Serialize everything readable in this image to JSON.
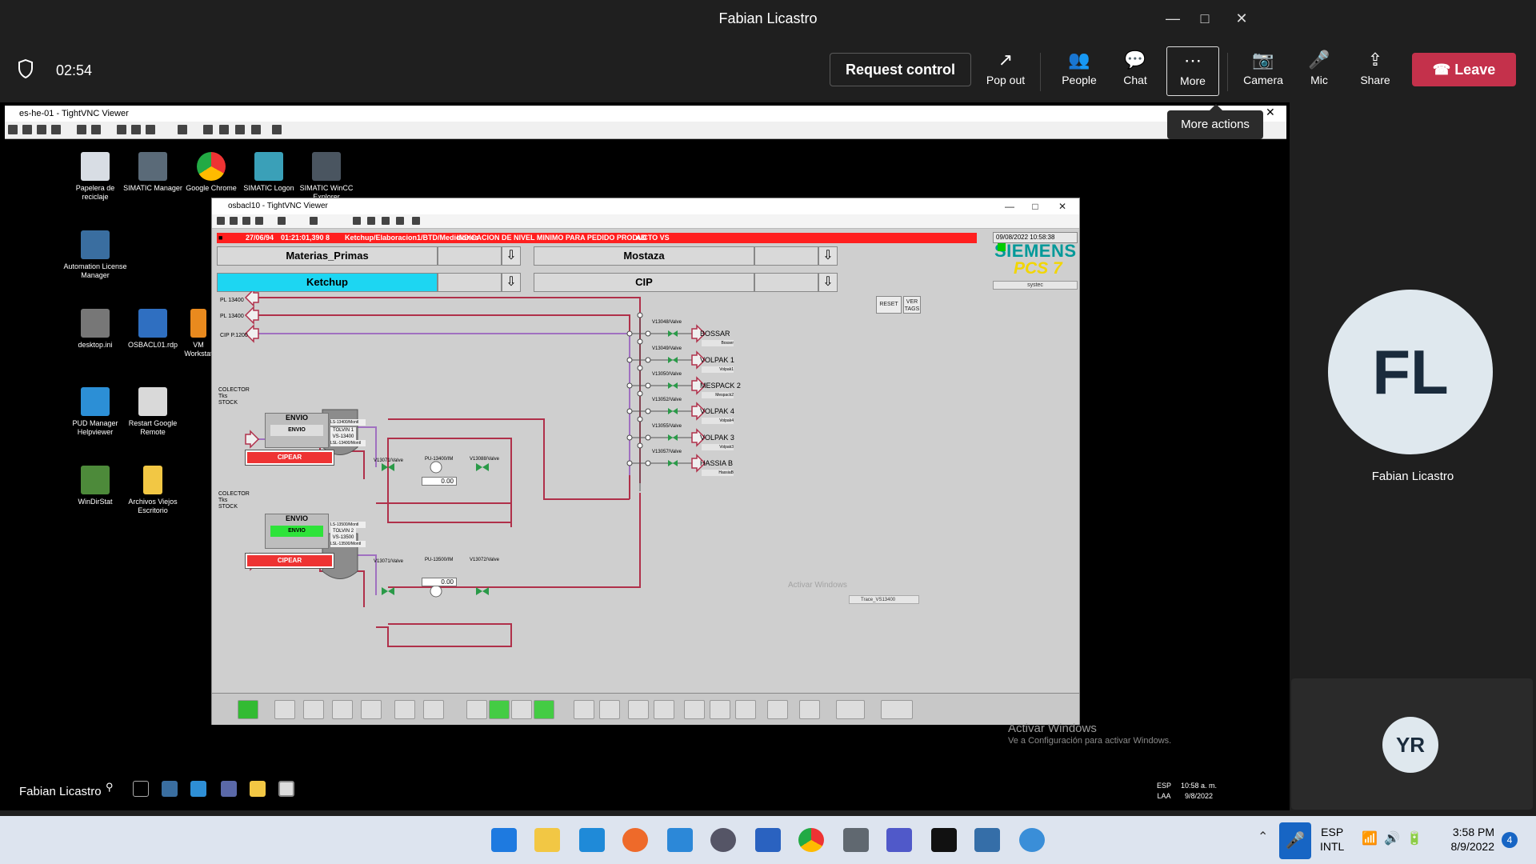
{
  "window": {
    "title": "Fabian Licastro"
  },
  "toolbar": {
    "timer": "02:54",
    "request_control": "Request control",
    "buttons": [
      {
        "label": "Pop out",
        "icon": "pop-out-icon"
      },
      {
        "label": "People",
        "icon": "people-icon"
      },
      {
        "label": "Chat",
        "icon": "chat-icon"
      },
      {
        "label": "More",
        "icon": "more-icon"
      },
      {
        "label": "Camera",
        "icon": "camera-off-icon"
      },
      {
        "label": "Mic",
        "icon": "mic-icon"
      },
      {
        "label": "Share",
        "icon": "share-icon"
      }
    ],
    "leave": "Leave",
    "tooltip": "More actions"
  },
  "remote": {
    "outer_title": "es-he-01 - TightVNC Viewer",
    "desktop_icons": [
      {
        "label": "Papelera de reciclaje"
      },
      {
        "label": "SIMATIC Manager"
      },
      {
        "label": "Google Chrome"
      },
      {
        "label": "SIMATIC Logon"
      },
      {
        "label": "SIMATIC WinCC Explorer"
      },
      {
        "label": "Automation License Manager"
      },
      {
        "label": "desktop.ini"
      },
      {
        "label": "OSBACL01.rdp"
      },
      {
        "label": "VM Workstat"
      },
      {
        "label": "PUD Manager Helpviewer"
      },
      {
        "label": "Restart Google Remote"
      },
      {
        "label": "WinDirStat"
      },
      {
        "label": "Archivos Viejos Escritorio"
      }
    ],
    "inner_title": "osbacl10 - TightVNC Viewer",
    "activate_windows": "Activar Windows",
    "activate_windows_sub": "Ve a Configuración para activar Windows.",
    "taskbar_name": "Fabian Licastro",
    "clock_lang": "ESP",
    "clock_lang2": "LAA",
    "clock_time": "10:58 a. m.",
    "clock_date": "9/8/2022"
  },
  "wincc": {
    "alarm": {
      "date": "27/06/94",
      "time": "01:21:01,390",
      "num": "8",
      "text": "Ketchup/Elaboracion1/BTD/Mediciones",
      "message": "INDICACION DE NIVEL MINIMO PARA PEDIDO PRODUCTO VS",
      "flag": "AD"
    },
    "datetime": "09/08/2022 10:58:38",
    "areas": [
      {
        "label": "Materias_Primas"
      },
      {
        "label": "Mostaza"
      },
      {
        "label": "Ketchup"
      },
      {
        "label": "CIP"
      }
    ],
    "brand": "SIEMENS",
    "product": "PCS 7",
    "systec": "systec",
    "reset": "RESET",
    "ver_tags": "VER TAGS",
    "sources": [
      {
        "label": "PL 13400"
      },
      {
        "label": "PL 13400"
      },
      {
        "label": "CIP P.1200"
      },
      {
        "label": "COLECTOR Tks STOCK"
      },
      {
        "label": "COLECTOR Tks STOCK"
      }
    ],
    "destinations": [
      {
        "label": "BOSSAR",
        "valve": "V13048/Valve",
        "sub": "Bosser"
      },
      {
        "label": "VOLPAK 1",
        "valve": "V13049/Valve",
        "sub": "Volpak1"
      },
      {
        "label": "MESPACK 2",
        "valve": "V13050/Valve",
        "sub": "Mespack2"
      },
      {
        "label": "VOLPAK 4",
        "valve": "V13052/Valve",
        "sub": "Volpak4"
      },
      {
        "label": "VOLPAK 3",
        "valve": "V13055/Valve",
        "sub": "Volpak3"
      },
      {
        "label": "HASSIA B",
        "valve": "V13057/Valve",
        "sub": "HassiaB"
      }
    ],
    "tanks": [
      {
        "envio": "ENVIO",
        "tolvin": "TOLVIN 1",
        "vs": "VS-13400",
        "ls_high": "LS-13400/Montl",
        "ls_low": "LSL-13400/Montl",
        "cipear": "CIPEAR",
        "value": "0.00",
        "v1": "V13071/Valve",
        "pump": "PU-13400/IM",
        "v2": "V13088/Valve"
      },
      {
        "envio": "ENVIO",
        "tolvin": "TOLVIN 2",
        "vs": "VS-13500",
        "ls_high": "LS-13500/Montl",
        "ls_low": "LSL-13500/Montl",
        "cipear": "CIPEAR",
        "value": "0.00",
        "v1": "V13071/Valve",
        "pump": "PU-13500/IM",
        "v2": "V13072/Valve"
      }
    ],
    "watermark": "Activar Windows",
    "trend": "Trace_VS13400"
  },
  "participant": {
    "initials": "FL",
    "name": "Fabian Licastro"
  },
  "self": {
    "initials": "YR"
  },
  "local_taskbar": {
    "lang1": "ESP",
    "lang2": "INTL",
    "time": "3:58 PM",
    "date": "8/9/2022",
    "badge": "4"
  },
  "colors": {
    "leave": "#c4314b",
    "ketchup_active": "#1dd6f2",
    "alarm": "#ff1f1f",
    "pipe": "#b0304a"
  }
}
